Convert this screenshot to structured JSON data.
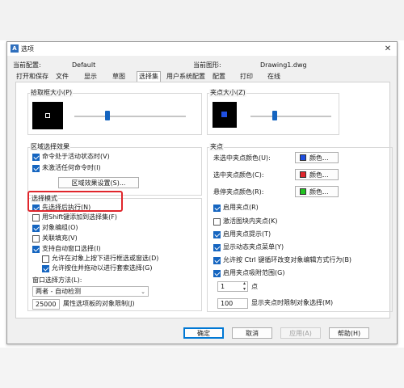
{
  "dialog": {
    "title": "选项",
    "current_profile_label": "当前配置:",
    "current_profile_value": "Default",
    "current_drawing_label": "当前图形:",
    "current_drawing_value": "Drawing1.dwg"
  },
  "tabs": [
    {
      "label": "打开和保存"
    },
    {
      "label": "文件"
    },
    {
      "label": "显示"
    },
    {
      "label": "草图"
    },
    {
      "label": "选择集",
      "active": true
    },
    {
      "label": "用户系统配置"
    },
    {
      "label": "配置"
    },
    {
      "label": "打印"
    },
    {
      "label": "在线"
    }
  ],
  "left": {
    "pickbox_title": "拾取框大小(P)",
    "pickbox_level": 0.3,
    "region_title": "区域选择效果",
    "region_opt1": "命令处于活动状态时(V)",
    "region_opt2": "未激活任何命令时(I)",
    "region_button": "区域效果设置(S)...",
    "mode_title": "选择模式",
    "mode_items": [
      {
        "label": "先选择后执行(N)",
        "checked": true
      },
      {
        "label": "用Shift键添加到选择集(F)",
        "checked": false
      },
      {
        "label": "对象编组(O)",
        "checked": true
      },
      {
        "label": "关联填充(V)",
        "checked": false
      },
      {
        "label": "支持自动窗口选择(I)",
        "checked": true
      }
    ],
    "mode_sub1": "允许在对象上按下进行框选或窗选(D)",
    "mode_sub2": "允许按住并拖动以进行套索选择(G)",
    "window_method_label": "窗口选择方法(L):",
    "window_method_value": "两者 - 自动检测",
    "limit_value": "25000",
    "limit_label": "属性选项板的对象限制(J)"
  },
  "right": {
    "gripsize_title": "夹点大小(Z)",
    "gripsize_level": 0.3,
    "grips_title": "夹点",
    "color1_label": "未选中夹点颜色(U):",
    "color2_label": "选中夹点颜色(C):",
    "color3_label": "悬停夹点颜色(R):",
    "color_button": "颜色...",
    "colors": {
      "unselected": "#1f4fe0",
      "selected": "#e0262c",
      "hover": "#22c322"
    },
    "grip_items": [
      {
        "label": "启用夹点(R)",
        "checked": true
      },
      {
        "label": "激活图块内夹点(K)",
        "checked": false
      },
      {
        "label": "启用夹点提示(T)",
        "checked": true
      },
      {
        "label": "显示动态夹点菜单(Y)",
        "checked": true
      },
      {
        "label": "允许按 Ctrl 键循环改变对象编辑方式行为(B)",
        "checked": true
      },
      {
        "label": "启用夹点吸附范围(G)",
        "checked": true
      }
    ],
    "snap_value": "1",
    "snap_unit": "点",
    "limit_value": "100",
    "limit_label": "显示夹点时限制对象选择(M)"
  },
  "footer": {
    "ok": "确定",
    "cancel": "取消",
    "apply": "应用(A)",
    "help": "帮助(H)"
  }
}
